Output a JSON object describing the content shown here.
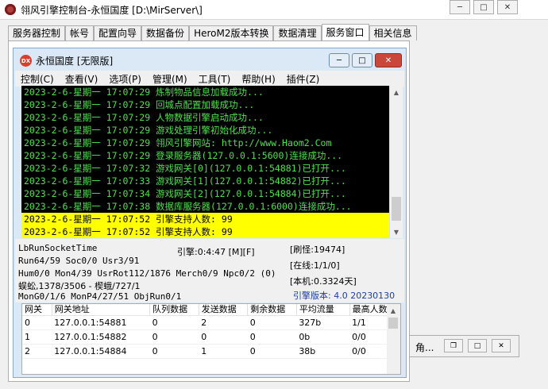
{
  "window": {
    "title": "翎风引擎控制台-永恒国度 [D:\\MirServer\\]"
  },
  "tabs": [
    "服务器控制",
    "帐号",
    "配置向导",
    "数据备份",
    "HeroM2版本转换",
    "数据清理",
    "服务窗口",
    "相关信息"
  ],
  "active_tab": "服务窗口",
  "background_panel": {
    "label": "角..."
  },
  "inner_window": {
    "title": "永恒国度 [无限版]",
    "icon_text": "DX",
    "menu": [
      "控制(C)",
      "查看(V)",
      "选项(P)",
      "管理(M)",
      "工具(T)",
      "帮助(H)",
      "插件(Z)"
    ]
  },
  "console": {
    "lines": [
      {
        "text": "2023-2-6-星期一  17:07:29 炼制物品信息加载成功...",
        "highlight": false
      },
      {
        "text": "2023-2-6-星期一  17:07:29 回城点配置加载成功...",
        "highlight": false
      },
      {
        "text": "2023-2-6-星期一  17:07:29 人物数据引擎启动成功...",
        "highlight": false
      },
      {
        "text": "2023-2-6-星期一  17:07:29 游戏处理引擎初始化成功...",
        "highlight": false
      },
      {
        "text": "2023-2-6-星期一  17:07:29 翎风引擎网站: http://www.Haom2.Com",
        "highlight": false
      },
      {
        "text": "2023-2-6-星期一  17:07:29 登录服务器(127.0.0.1:5600)连接成功...",
        "highlight": false
      },
      {
        "text": "2023-2-6-星期一  17:07:32 游戏网关[0](127.0.0.1:54881)已打开...",
        "highlight": false
      },
      {
        "text": "2023-2-6-星期一  17:07:33 游戏网关[1](127.0.0.1:54882)已打开...",
        "highlight": false
      },
      {
        "text": "2023-2-6-星期一  17:07:34 游戏网关[2](127.0.0.1:54884)已打开...",
        "highlight": false
      },
      {
        "text": "2023-2-6-星期一  17:07:38 数据库服务器(127.0.0.1:6000)连接成功...",
        "highlight": false
      },
      {
        "text": "2023-2-6-星期一  17:07:52 引擎支持人数: 99",
        "highlight": true
      },
      {
        "text": "2023-2-6-星期一  17:07:52 引擎支持人数: 99",
        "highlight": true
      }
    ]
  },
  "status": {
    "run_time_label": "LbRunSocketTime",
    "engine_time": "引擎:0:4:47 [M][F]",
    "refresh": "[刷怪:19474]",
    "run_line": "Run64/59 Soc0/0 Usr3/91",
    "online": "[在线:1/1/0]",
    "hum_line": "Hum0/0 Mon4/39 UsrRot112/1876 Merch0/9 Npc0/2 (0)",
    "local": "[本机:0.3324天]",
    "monster_line": "蜈蚣,1378/3506 - 楔蛾/727/1",
    "version": "引擎版本: 4.0 20230130",
    "mon_line": "MonG0/1/6 MonP4/27/51 ObjRun0/1"
  },
  "colors": {
    "version_text": "#1f3fa0",
    "console_text": "#4ee04e",
    "highlight_bg": "#ffff00"
  },
  "gateway_table": {
    "columns": [
      "网关",
      "网关地址",
      "队列数据",
      "发送数据",
      "剩余数据",
      "平均流量",
      "最高人数"
    ],
    "rows": [
      [
        "0",
        "127.0.0.1:54881",
        "0",
        "2",
        "0",
        "327b",
        "1/1"
      ],
      [
        "1",
        "127.0.0.1:54882",
        "0",
        "0",
        "0",
        "0b",
        "0/0"
      ],
      [
        "2",
        "127.0.0.1:54884",
        "0",
        "1",
        "0",
        "38b",
        "0/0"
      ]
    ]
  }
}
